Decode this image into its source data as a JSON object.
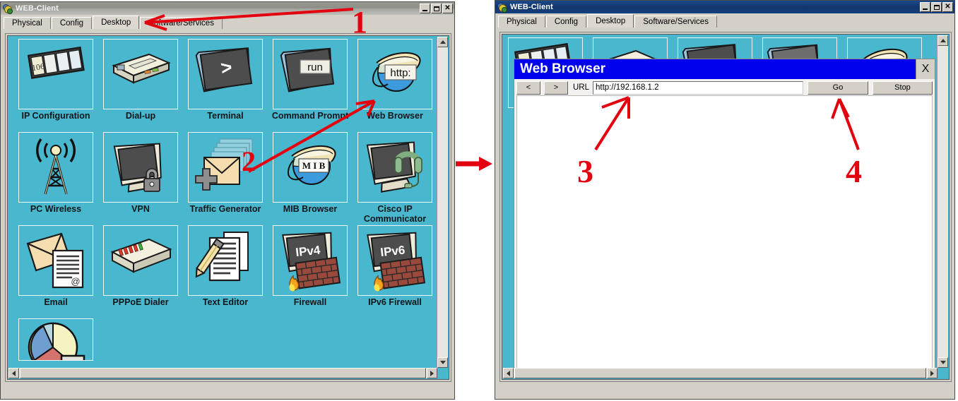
{
  "left_window": {
    "title": "WEB-Client",
    "title_icon": "packet-tracer-logo-icon",
    "window_buttons": {
      "minimize": "_",
      "maximize": "□",
      "close": "X"
    },
    "tabs": [
      {
        "label": "Physical",
        "active": false
      },
      {
        "label": "Config",
        "active": false
      },
      {
        "label": "Desktop",
        "active": true
      },
      {
        "label": "Software/Services",
        "active": false
      }
    ],
    "desktop_icons": [
      {
        "label": "IP Configuration",
        "icon": "ip-configuration-icon",
        "badge": "106"
      },
      {
        "label": "Dial-up",
        "icon": "dial-up-modem-icon"
      },
      {
        "label": "Terminal",
        "icon": "terminal-icon",
        "glyph": ">"
      },
      {
        "label": "Command Prompt",
        "icon": "command-prompt-icon",
        "glyph": "run"
      },
      {
        "label": "Web Browser",
        "icon": "web-browser-icon",
        "glyph": "http:"
      },
      {
        "label": "PC Wireless",
        "icon": "pc-wireless-antenna-icon"
      },
      {
        "label": "VPN",
        "icon": "vpn-lock-icon"
      },
      {
        "label": "Traffic Generator",
        "icon": "traffic-generator-icon"
      },
      {
        "label": "MIB Browser",
        "icon": "mib-browser-icon",
        "glyph": "M I B"
      },
      {
        "label": "Cisco IP Communicator",
        "icon": "cisco-ip-communicator-icon"
      },
      {
        "label": "Email",
        "icon": "email-icon"
      },
      {
        "label": "PPPoE Dialer",
        "icon": "pppoe-dialer-icon"
      },
      {
        "label": "Text Editor",
        "icon": "text-editor-icon"
      },
      {
        "label": "Firewall",
        "icon": "firewall-icon",
        "glyph": "IPv4"
      },
      {
        "label": "IPv6 Firewall",
        "icon": "ipv6-firewall-icon",
        "glyph": "IPv6"
      },
      {
        "label": "",
        "icon": "pie-chart-icon"
      }
    ]
  },
  "right_window": {
    "title": "WEB-Client",
    "title_icon": "packet-tracer-logo-icon",
    "window_buttons": {
      "minimize": "_",
      "maximize": "□",
      "close": "X"
    },
    "tabs": [
      {
        "label": "Physical",
        "active": false
      },
      {
        "label": "Config",
        "active": false
      },
      {
        "label": "Desktop",
        "active": true
      },
      {
        "label": "Software/Services",
        "active": false
      }
    ],
    "web_browser": {
      "title": "Web Browser",
      "close_label": "X",
      "back_label": "<",
      "forward_label": ">",
      "url_label": "URL",
      "url_value": "http://192.168.1.2",
      "url_placeholder": "",
      "go_label": "Go",
      "stop_label": "Stop",
      "page_content": ""
    }
  },
  "annotations": {
    "accent_color": "#e3000f",
    "markers": [
      {
        "id": "1",
        "target": "desktop-tab",
        "note": "arrow pointing to Desktop tab"
      },
      {
        "id": "2",
        "target": "web-browser-icon",
        "note": "arrow pointing to Web Browser desktop icon"
      },
      {
        "id": "3",
        "target": "url-input",
        "note": "arrow pointing to URL field"
      },
      {
        "id": "4",
        "target": "go-button",
        "note": "arrow pointing to Go button"
      }
    ],
    "flow_arrow": "right-arrow-between-windows"
  },
  "colors": {
    "desktop_teal": "#49b7cd",
    "dialog_titlebar_blue": "#0000ee",
    "window_chrome": "#d4d0c8",
    "active_titlebar": "#15407e",
    "inactive_titlebar": "#9a9a94",
    "annotation_red": "#e3000f"
  }
}
